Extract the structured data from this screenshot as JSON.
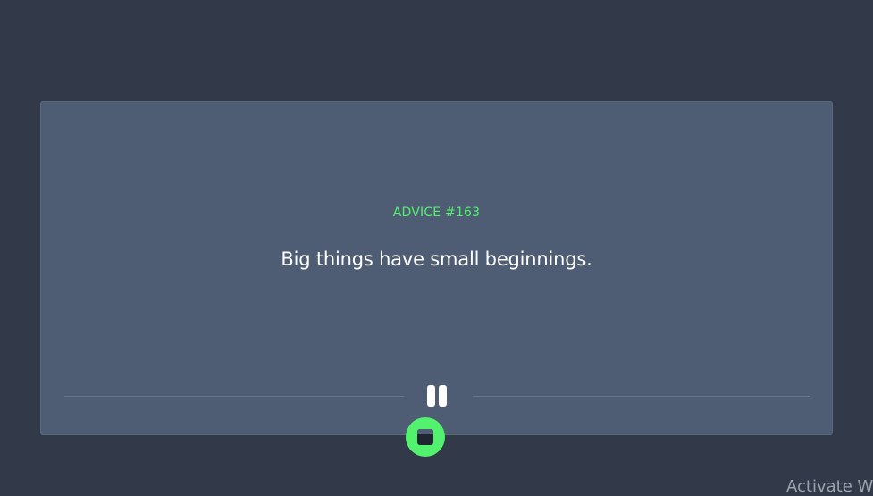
{
  "card": {
    "advice_id": "ADVICE #163",
    "advice_text": "Big things have small beginnings."
  },
  "icons": {
    "pause": "pause-icon",
    "dice": "dice-icon"
  },
  "watermark": "Activate Wi",
  "colors": {
    "background": "#323a49",
    "card": "#4e5d73",
    "accent": "#52f26e",
    "text": "#ffffff"
  }
}
